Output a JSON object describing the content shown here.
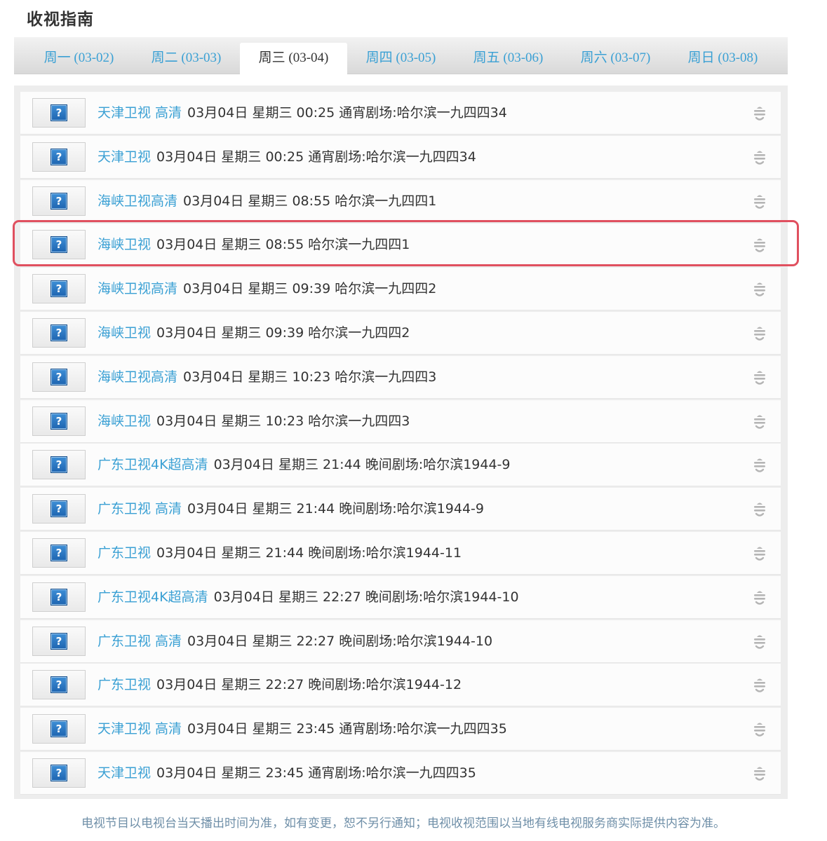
{
  "page": {
    "title": "收视指南"
  },
  "tabs": [
    {
      "label": "周一 (03-02)",
      "active": false
    },
    {
      "label": "周二 (03-03)",
      "active": false
    },
    {
      "label": "周三 (03-04)",
      "active": true
    },
    {
      "label": "周四 (03-05)",
      "active": false
    },
    {
      "label": "周五 (03-06)",
      "active": false
    },
    {
      "label": "周六 (03-07)",
      "active": false
    },
    {
      "label": "周日 (03-08)",
      "active": false
    }
  ],
  "programs": [
    {
      "channel": "天津卫视 高清",
      "info": "03月04日 星期三 00:25 通宵剧场:哈尔滨一九四四34",
      "thumb_glyph": "?"
    },
    {
      "channel": "天津卫视",
      "info": "03月04日 星期三 00:25 通宵剧场:哈尔滨一九四四34",
      "thumb_glyph": "?"
    },
    {
      "channel": "海峡卫视高清",
      "info": "03月04日 星期三 08:55 哈尔滨一九四四1",
      "thumb_glyph": "?"
    },
    {
      "channel": "海峡卫视",
      "info": "03月04日 星期三 08:55 哈尔滨一九四四1",
      "thumb_glyph": "?"
    },
    {
      "channel": "海峡卫视高清",
      "info": "03月04日 星期三 09:39 哈尔滨一九四四2",
      "thumb_glyph": "?"
    },
    {
      "channel": "海峡卫视",
      "info": "03月04日 星期三 09:39 哈尔滨一九四四2",
      "thumb_glyph": "?"
    },
    {
      "channel": "海峡卫视高清",
      "info": "03月04日 星期三 10:23 哈尔滨一九四四3",
      "thumb_glyph": "?"
    },
    {
      "channel": "海峡卫视",
      "info": "03月04日 星期三 10:23 哈尔滨一九四四3",
      "thumb_glyph": "?"
    },
    {
      "channel": "广东卫视4K超高清",
      "info": "03月04日 星期三 21:44 晚间剧场:哈尔滨1944-9",
      "thumb_glyph": "?"
    },
    {
      "channel": "广东卫视 高清",
      "info": "03月04日 星期三 21:44 晚间剧场:哈尔滨1944-9",
      "thumb_glyph": "?"
    },
    {
      "channel": "广东卫视",
      "info": "03月04日 星期三 21:44 晚间剧场:哈尔滨1944-11",
      "thumb_glyph": "?"
    },
    {
      "channel": "广东卫视4K超高清",
      "info": "03月04日 星期三 22:27 晚间剧场:哈尔滨1944-10",
      "thumb_glyph": "?"
    },
    {
      "channel": "广东卫视 高清",
      "info": "03月04日 星期三 22:27 晚间剧场:哈尔滨1944-10",
      "thumb_glyph": "?"
    },
    {
      "channel": "广东卫视",
      "info": "03月04日 星期三 22:27 晚间剧场:哈尔滨1944-12",
      "thumb_glyph": "?"
    },
    {
      "channel": "天津卫视 高清",
      "info": "03月04日 星期三 23:45 通宵剧场:哈尔滨一九四四35",
      "thumb_glyph": "?"
    },
    {
      "channel": "天津卫视",
      "info": "03月04日 星期三 23:45 通宵剧场:哈尔滨一九四四35",
      "thumb_glyph": "?"
    }
  ],
  "highlighted_row": 3,
  "icons": {
    "thumbnail": "question-mark-icon",
    "reminder": "bell-icon"
  },
  "colors": {
    "link": "#3aa0d4",
    "text": "#333333",
    "highlight": "#e0505f",
    "footer": "#6f8fa8"
  },
  "footer": {
    "note": "电视节目以电视台当天播出时间为准，如有变更，恕不另行通知；电视收视范围以当地有线电视服务商实际提供内容为准。"
  }
}
